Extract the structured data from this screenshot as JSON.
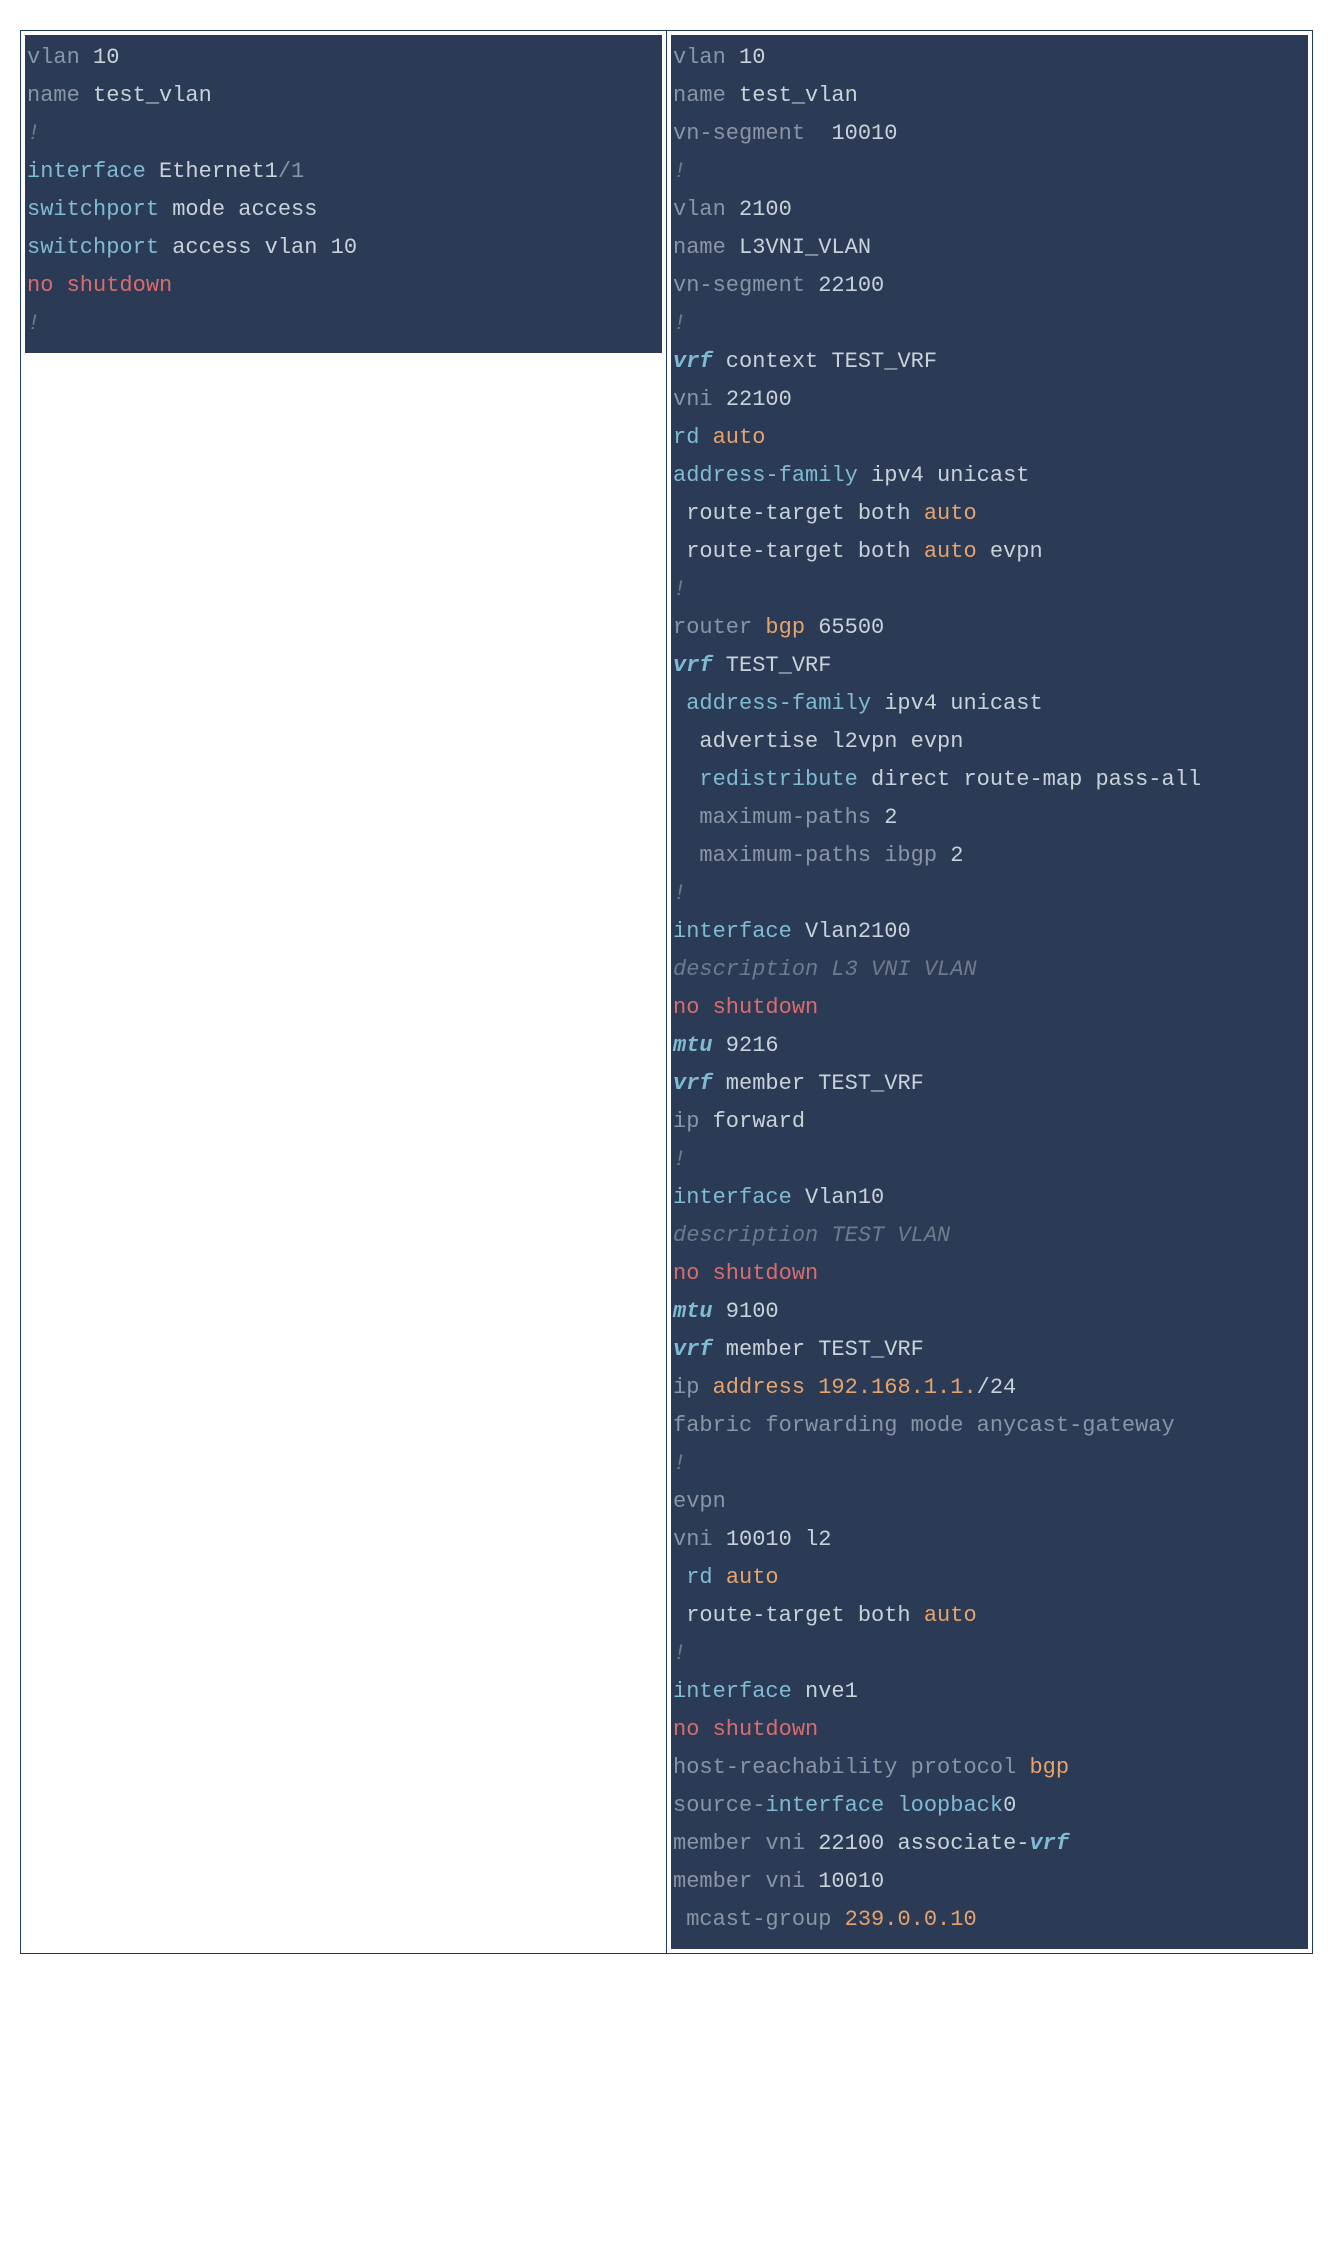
{
  "left": {
    "lines": [
      [
        {
          "t": "vlan ",
          "c": "muted"
        },
        {
          "t": "10",
          "c": "default"
        }
      ],
      [
        {
          "t": "name ",
          "c": "muted"
        },
        {
          "t": "test_vlan",
          "c": "default"
        }
      ],
      [
        {
          "t": "!",
          "c": "comment"
        }
      ],
      [
        {
          "t": "interface ",
          "c": "key"
        },
        {
          "t": "Ethernet1",
          "c": "default"
        },
        {
          "t": "/1",
          "c": "muted"
        }
      ],
      [
        {
          "t": "switchport ",
          "c": "key"
        },
        {
          "t": "mode access",
          "c": "default"
        }
      ],
      [
        {
          "t": "switchport ",
          "c": "key"
        },
        {
          "t": "access vlan ",
          "c": "default"
        },
        {
          "t": "10",
          "c": "default"
        }
      ],
      [
        {
          "t": "no shutdown",
          "c": "red"
        }
      ],
      [
        {
          "t": "!",
          "c": "comment"
        }
      ]
    ]
  },
  "right": {
    "lines": [
      [
        {
          "t": "vlan ",
          "c": "muted"
        },
        {
          "t": "10",
          "c": "default"
        }
      ],
      [
        {
          "t": "name ",
          "c": "muted"
        },
        {
          "t": "test_vlan",
          "c": "default"
        }
      ],
      [
        {
          "t": "vn-segment  ",
          "c": "muted"
        },
        {
          "t": "10010",
          "c": "default"
        }
      ],
      [
        {
          "t": "!",
          "c": "comment"
        }
      ],
      [
        {
          "t": "vlan ",
          "c": "muted"
        },
        {
          "t": "2100",
          "c": "default"
        }
      ],
      [
        {
          "t": "name ",
          "c": "muted"
        },
        {
          "t": "L3VNI_VLAN",
          "c": "default"
        }
      ],
      [
        {
          "t": "vn-segment ",
          "c": "muted"
        },
        {
          "t": "22100",
          "c": "default"
        }
      ],
      [
        {
          "t": "!",
          "c": "comment"
        }
      ],
      [
        {
          "t": "vrf",
          "c": "key-em"
        },
        {
          "t": " context TEST_VRF",
          "c": "default"
        }
      ],
      [
        {
          "t": "vni ",
          "c": "muted"
        },
        {
          "t": "22100",
          "c": "default"
        }
      ],
      [
        {
          "t": "rd ",
          "c": "key"
        },
        {
          "t": "auto",
          "c": "orange"
        }
      ],
      [
        {
          "t": "address-family ",
          "c": "key"
        },
        {
          "t": "ipv4 unicast",
          "c": "default"
        }
      ],
      [
        {
          "t": " route-target both ",
          "c": "default"
        },
        {
          "t": "auto",
          "c": "orange"
        }
      ],
      [
        {
          "t": " route-target both ",
          "c": "default"
        },
        {
          "t": "auto",
          "c": "orange"
        },
        {
          "t": " evpn",
          "c": "default"
        }
      ],
      [
        {
          "t": "!",
          "c": "comment"
        }
      ],
      [
        {
          "t": "router ",
          "c": "muted"
        },
        {
          "t": "bgp",
          "c": "orange"
        },
        {
          "t": " 65500",
          "c": "default"
        }
      ],
      [
        {
          "t": "vrf",
          "c": "key-em"
        },
        {
          "t": " TEST_VRF",
          "c": "default"
        }
      ],
      [
        {
          "t": " address-family ",
          "c": "key"
        },
        {
          "t": "ipv4 unicast",
          "c": "default"
        }
      ],
      [
        {
          "t": "  advertise l2vpn evpn",
          "c": "default"
        }
      ],
      [
        {
          "t": "  redistribute ",
          "c": "key"
        },
        {
          "t": "direct route-map pass-all",
          "c": "default"
        }
      ],
      [
        {
          "t": "  maximum-paths ",
          "c": "muted"
        },
        {
          "t": "2",
          "c": "default"
        }
      ],
      [
        {
          "t": "  maximum-paths ibgp ",
          "c": "muted"
        },
        {
          "t": "2",
          "c": "default"
        }
      ],
      [
        {
          "t": "!",
          "c": "comment"
        }
      ],
      [
        {
          "t": "interface ",
          "c": "key"
        },
        {
          "t": "Vlan2100",
          "c": "default"
        }
      ],
      [
        {
          "t": "description L3 VNI VLAN",
          "c": "comment"
        }
      ],
      [
        {
          "t": "no shutdown",
          "c": "red"
        }
      ],
      [
        {
          "t": "mtu",
          "c": "key-em"
        },
        {
          "t": " 9216",
          "c": "default"
        }
      ],
      [
        {
          "t": "vrf",
          "c": "key-em"
        },
        {
          "t": " member TEST_VRF",
          "c": "default"
        }
      ],
      [
        {
          "t": "ip ",
          "c": "muted"
        },
        {
          "t": "forward",
          "c": "default"
        }
      ],
      [
        {
          "t": "!",
          "c": "comment"
        }
      ],
      [
        {
          "t": "interface ",
          "c": "key"
        },
        {
          "t": "Vlan10",
          "c": "default"
        }
      ],
      [
        {
          "t": "description TEST VLAN",
          "c": "comment"
        }
      ],
      [
        {
          "t": "no shutdown",
          "c": "red"
        }
      ],
      [
        {
          "t": "mtu",
          "c": "key-em"
        },
        {
          "t": " 9100",
          "c": "default"
        }
      ],
      [
        {
          "t": "vrf",
          "c": "key-em"
        },
        {
          "t": " member TEST_VRF",
          "c": "default"
        }
      ],
      [
        {
          "t": "ip ",
          "c": "muted"
        },
        {
          "t": "address 192.168.1.1.",
          "c": "orange"
        },
        {
          "t": "/24",
          "c": "default"
        }
      ],
      [
        {
          "t": "fabric forwarding mode anycast-gateway",
          "c": "muted"
        }
      ],
      [
        {
          "t": "!",
          "c": "comment"
        }
      ],
      [
        {
          "t": "evpn",
          "c": "muted"
        }
      ],
      [
        {
          "t": "vni ",
          "c": "muted"
        },
        {
          "t": "10010 ",
          "c": "default"
        },
        {
          "t": "l2",
          "c": "default"
        }
      ],
      [
        {
          "t": " rd ",
          "c": "key"
        },
        {
          "t": "auto",
          "c": "orange"
        }
      ],
      [
        {
          "t": " route-target both ",
          "c": "default"
        },
        {
          "t": "auto",
          "c": "orange"
        }
      ],
      [
        {
          "t": "!",
          "c": "comment"
        }
      ],
      [
        {
          "t": "interface ",
          "c": "key"
        },
        {
          "t": "nve1",
          "c": "default"
        }
      ],
      [
        {
          "t": "no shutdown",
          "c": "red"
        }
      ],
      [
        {
          "t": "host-reachability protocol ",
          "c": "muted"
        },
        {
          "t": "bgp",
          "c": "orange"
        }
      ],
      [
        {
          "t": "source-",
          "c": "muted"
        },
        {
          "t": "interface loopback",
          "c": "key"
        },
        {
          "t": "0",
          "c": "default"
        }
      ],
      [
        {
          "t": "member vni ",
          "c": "muted"
        },
        {
          "t": "22100 ",
          "c": "default"
        },
        {
          "t": "associate-",
          "c": "default"
        },
        {
          "t": "vrf",
          "c": "key-em"
        }
      ],
      [
        {
          "t": "member vni ",
          "c": "muted"
        },
        {
          "t": "10010",
          "c": "default"
        }
      ],
      [
        {
          "t": " mcast-group ",
          "c": "muted"
        },
        {
          "t": "239.0.0.10",
          "c": "orange"
        }
      ]
    ]
  }
}
